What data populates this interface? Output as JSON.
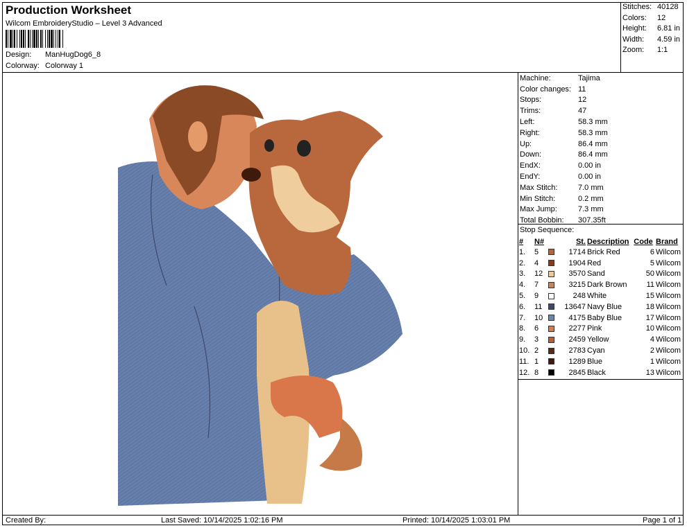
{
  "header": {
    "title": "Production Worksheet",
    "subtitle": "Wilcom EmbroideryStudio – Level 3 Advanced",
    "design_label": "Design:",
    "design_value": "ManHugDog6_8",
    "colorway_label": "Colorway:",
    "colorway_value": "Colorway 1"
  },
  "summary": [
    {
      "label": "Stitches:",
      "value": "40128"
    },
    {
      "label": "Colors:",
      "value": "12"
    },
    {
      "label": "Height:",
      "value": "6.81 in"
    },
    {
      "label": "Width:",
      "value": "4.59 in"
    },
    {
      "label": "Zoom:",
      "value": "1:1"
    }
  ],
  "machine_info": [
    {
      "label": "Machine:",
      "value": "Tajima"
    },
    {
      "label": "Color changes:",
      "value": "11"
    },
    {
      "label": "Stops:",
      "value": "12"
    },
    {
      "label": "Trims:",
      "value": "47"
    },
    {
      "label": "Left:",
      "value": "58.3 mm"
    },
    {
      "label": "Right:",
      "value": "58.3 mm"
    },
    {
      "label": "Up:",
      "value": "86.4 mm"
    },
    {
      "label": "Down:",
      "value": "86.4 mm"
    },
    {
      "label": "EndX:",
      "value": "0.00 in"
    },
    {
      "label": "EndY:",
      "value": "0.00 in"
    },
    {
      "label": "Max Stitch:",
      "value": "7.0 mm"
    },
    {
      "label": "Min Stitch:",
      "value": "0.2 mm"
    },
    {
      "label": "Max Jump:",
      "value": "7.3 mm"
    },
    {
      "label": "Total Bobbin:",
      "value": "307.35ft"
    }
  ],
  "stop_sequence": {
    "title": "Stop Sequence:",
    "headers": {
      "num": "#",
      "n": "N#",
      "st": "St.",
      "description": "Description",
      "code": "Code",
      "brand": "Brand"
    },
    "rows": [
      {
        "num": "1.",
        "n": "5",
        "color": "#b5653a",
        "st": "1714",
        "description": "Brick Red",
        "code": "6",
        "brand": "Wilcom"
      },
      {
        "num": "2.",
        "n": "4",
        "color": "#8a3b1c",
        "st": "1904",
        "description": "Red",
        "code": "5",
        "brand": "Wilcom"
      },
      {
        "num": "3.",
        "n": "12",
        "color": "#efc999",
        "st": "3570",
        "description": "Sand",
        "code": "50",
        "brand": "Wilcom"
      },
      {
        "num": "4.",
        "n": "7",
        "color": "#c9825e",
        "st": "3215",
        "description": "Dark Brown",
        "code": "11",
        "brand": "Wilcom"
      },
      {
        "num": "5.",
        "n": "9",
        "color": "#ffffff",
        "st": "248",
        "description": "White",
        "code": "15",
        "brand": "Wilcom"
      },
      {
        "num": "6.",
        "n": "11",
        "color": "#3d4a6e",
        "st": "13647",
        "description": "Navy Blue",
        "code": "18",
        "brand": "Wilcom"
      },
      {
        "num": "7.",
        "n": "10",
        "color": "#6a86b5",
        "st": "4175",
        "description": "Baby Blue",
        "code": "17",
        "brand": "Wilcom"
      },
      {
        "num": "8.",
        "n": "6",
        "color": "#e0784a",
        "st": "2277",
        "description": "Pink",
        "code": "10",
        "brand": "Wilcom"
      },
      {
        "num": "9.",
        "n": "3",
        "color": "#c45a32",
        "st": "2459",
        "description": "Yellow",
        "code": "4",
        "brand": "Wilcom"
      },
      {
        "num": "10.",
        "n": "2",
        "color": "#5a2a14",
        "st": "2783",
        "description": "Cyan",
        "code": "2",
        "brand": "Wilcom"
      },
      {
        "num": "11.",
        "n": "1",
        "color": "#3e1a0c",
        "st": "1289",
        "description": "Blue",
        "code": "1",
        "brand": "Wilcom"
      },
      {
        "num": "12.",
        "n": "8",
        "color": "#000000",
        "st": "2845",
        "description": "Black",
        "code": "13",
        "brand": "Wilcom"
      }
    ]
  },
  "footer": {
    "created_by": "Created By:",
    "last_saved": "Last Saved: 10/14/2025 1:02:16 PM",
    "printed": "Printed: 10/14/2025 1:03:01 PM",
    "page": "Page 1 of 1"
  }
}
